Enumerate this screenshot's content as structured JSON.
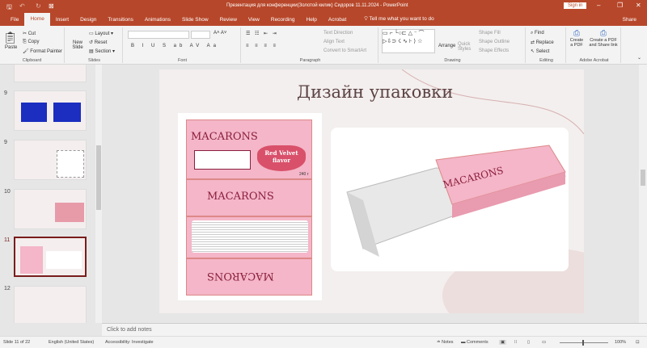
{
  "titlebar": {
    "title": "Презентация для конференции(Золотой килик) Сидоров 11.11.2024 - PowerPoint",
    "sign_in": "Sign in",
    "share": "Share"
  },
  "tabs": [
    "File",
    "Home",
    "Insert",
    "Design",
    "Transitions",
    "Animations",
    "Slide Show",
    "Review",
    "View",
    "Recording",
    "Help",
    "Acrobat"
  ],
  "tell_me": "Tell me what you want to do",
  "ribbon": {
    "clipboard": {
      "paste": "Paste",
      "cut": "Cut",
      "copy": "Copy",
      "format_painter": "Format Painter",
      "label": "Clipboard"
    },
    "slides": {
      "new_slide": "New Slide",
      "layout": "Layout",
      "reset": "Reset",
      "section": "Section",
      "label": "Slides"
    },
    "font": {
      "label": "Font"
    },
    "paragraph": {
      "text_direction": "Text Direction",
      "align_text": "Align Text",
      "smartart": "Convert to SmartArt",
      "label": "Paragraph"
    },
    "drawing": {
      "arrange": "Arrange",
      "quick_styles": "Quick Styles",
      "shape_fill": "Shape Fill",
      "shape_outline": "Shape Outline",
      "shape_effects": "Shape Effects",
      "label": "Drawing"
    },
    "editing": {
      "find": "Find",
      "replace": "Replace",
      "select": "Select",
      "label": "Editing"
    },
    "acrobat": {
      "create_pdf": "Create a PDF",
      "create_share": "Create a PDF and Share link",
      "label": "Adobe Acrobat"
    }
  },
  "thumbnails": [
    {
      "num": "9"
    },
    {
      "num": "9"
    },
    {
      "num": "10"
    },
    {
      "num": "11",
      "selected": true
    },
    {
      "num": "12"
    }
  ],
  "slide": {
    "title": "Дизайн упаковки",
    "brand": "MACARONS",
    "flavor": "Red Velvet flavor",
    "weight": "240 г"
  },
  "notes_placeholder": "Click to add notes",
  "status": {
    "slide": "Slide 11 of 22",
    "language": "English (United States)",
    "accessibility": "Accessibility: Investigate",
    "notes": "Notes",
    "comments": "Comments",
    "zoom": "100%"
  },
  "colors": {
    "accent": "#b7472a",
    "pink": "#f4b6c8",
    "maroon": "#8b1e3f"
  }
}
